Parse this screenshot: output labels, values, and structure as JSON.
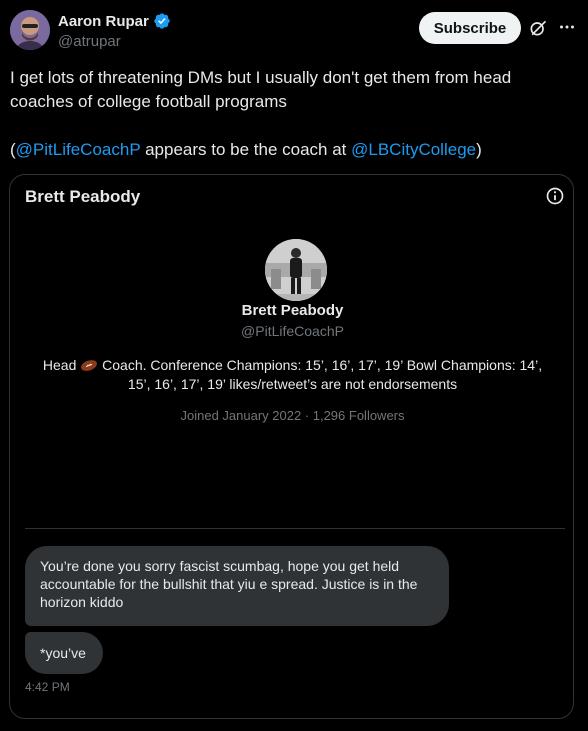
{
  "author": {
    "display_name": "Aaron Rupar",
    "handle": "@atrupar",
    "avatar_icon": "person-avatar",
    "verified_icon": "verified-badge-icon",
    "verified_color": "#1d9bf0"
  },
  "header": {
    "subscribe_label": "Subscribe",
    "grok_icon": "grok-icon",
    "more_icon": "more-icon"
  },
  "tweet": {
    "line1": "I get lots of threatening DMs but I usually don't get them from head coaches of college football programs",
    "paren_open": "(",
    "mention1": "@PitLifeCoachP",
    "middle": " appears to be the coach at ",
    "mention2": "@LBCityCollege",
    "paren_close": ")"
  },
  "dm_card": {
    "title": "Brett Peabody",
    "info_icon": "info-icon",
    "profile": {
      "name": "Brett Peabody",
      "handle": "@PitLifeCoachP",
      "bio_before_icon": "Head ",
      "bio_icon": "football-icon",
      "bio_after_icon": " Coach. Conference Champions: 15’, 16’, 17’, 19’ Bowl Champions: 14’, 15’, 16’, 17’, 19’ likes/retweet’s are not endorsements",
      "joined": "Joined January 2022 · 1,296 Followers"
    },
    "messages": [
      {
        "text": "You’re done you sorry fascist scumbag, hope you get held accountable for the bullshit that yiu e spread. Justice is in the horizon kiddo"
      },
      {
        "text": "*you’ve"
      }
    ],
    "timestamp": "4:42 PM"
  },
  "colors": {
    "background": "#000000",
    "text": "#e7e9ea",
    "muted": "#71767b",
    "link": "#1d9bf0",
    "bubble": "#2f3336"
  }
}
